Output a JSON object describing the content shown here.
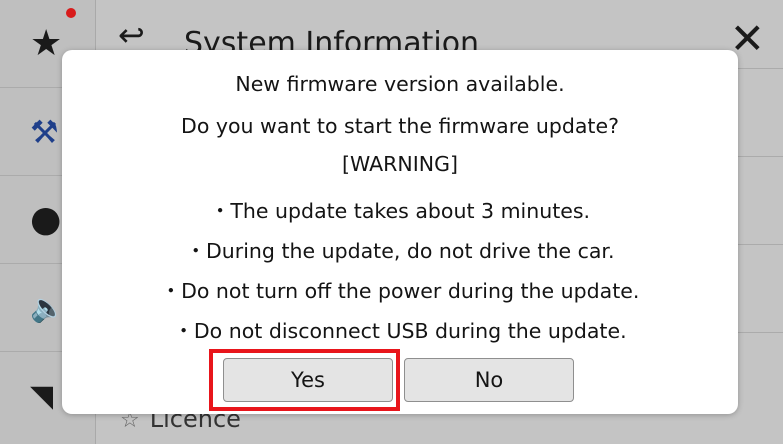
{
  "background": {
    "header": {
      "title": "System Information",
      "back_icon": "back-arrow-icon",
      "close_icon": "close-icon"
    },
    "sidebar": {
      "items": [
        {
          "icon": "star-icon",
          "has_badge": true
        },
        {
          "icon": "tools-icon"
        },
        {
          "icon": "car-icon"
        },
        {
          "icon": "speaker-icon"
        },
        {
          "icon": "wireless-icon"
        }
      ]
    },
    "list": {
      "visible_item": "Licence"
    }
  },
  "dialog": {
    "lines": [
      "New firmware version available.",
      "Do you want to start the firmware update?",
      "[WARNING]",
      "・The update takes about 3 minutes.",
      "・During the update, do not drive the car.",
      "・Do not turn off the power during the update.",
      "・Do not disconnect USB during the update."
    ],
    "yes_label": "Yes",
    "no_label": "No"
  },
  "colors": {
    "highlight": "#e8151b",
    "badge": "#d81b1b",
    "dialog_bg": "#ffffff",
    "button_bg": "#e4e4e4"
  }
}
